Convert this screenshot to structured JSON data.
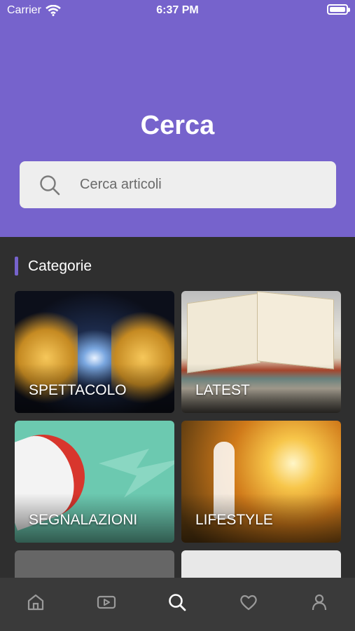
{
  "status_bar": {
    "carrier": "Carrier",
    "time": "6:37 PM"
  },
  "header": {
    "title": "Cerca"
  },
  "search": {
    "placeholder": "Cerca articoli"
  },
  "categories": {
    "title": "Categorie",
    "items": [
      {
        "label": "SPETTACOLO"
      },
      {
        "label": "LATEST"
      },
      {
        "label": "SEGNALAZIONI"
      },
      {
        "label": "LIFESTYLE"
      }
    ]
  },
  "tabbar": {
    "tabs": [
      {
        "icon": "home-icon",
        "active": false
      },
      {
        "icon": "video-icon",
        "active": false
      },
      {
        "icon": "search-icon",
        "active": true
      },
      {
        "icon": "heart-icon",
        "active": false
      },
      {
        "icon": "user-icon",
        "active": false
      }
    ]
  },
  "colors": {
    "accent": "#7663cc",
    "background": "#2f2f2f",
    "tabbar": "#3a3a3a"
  }
}
